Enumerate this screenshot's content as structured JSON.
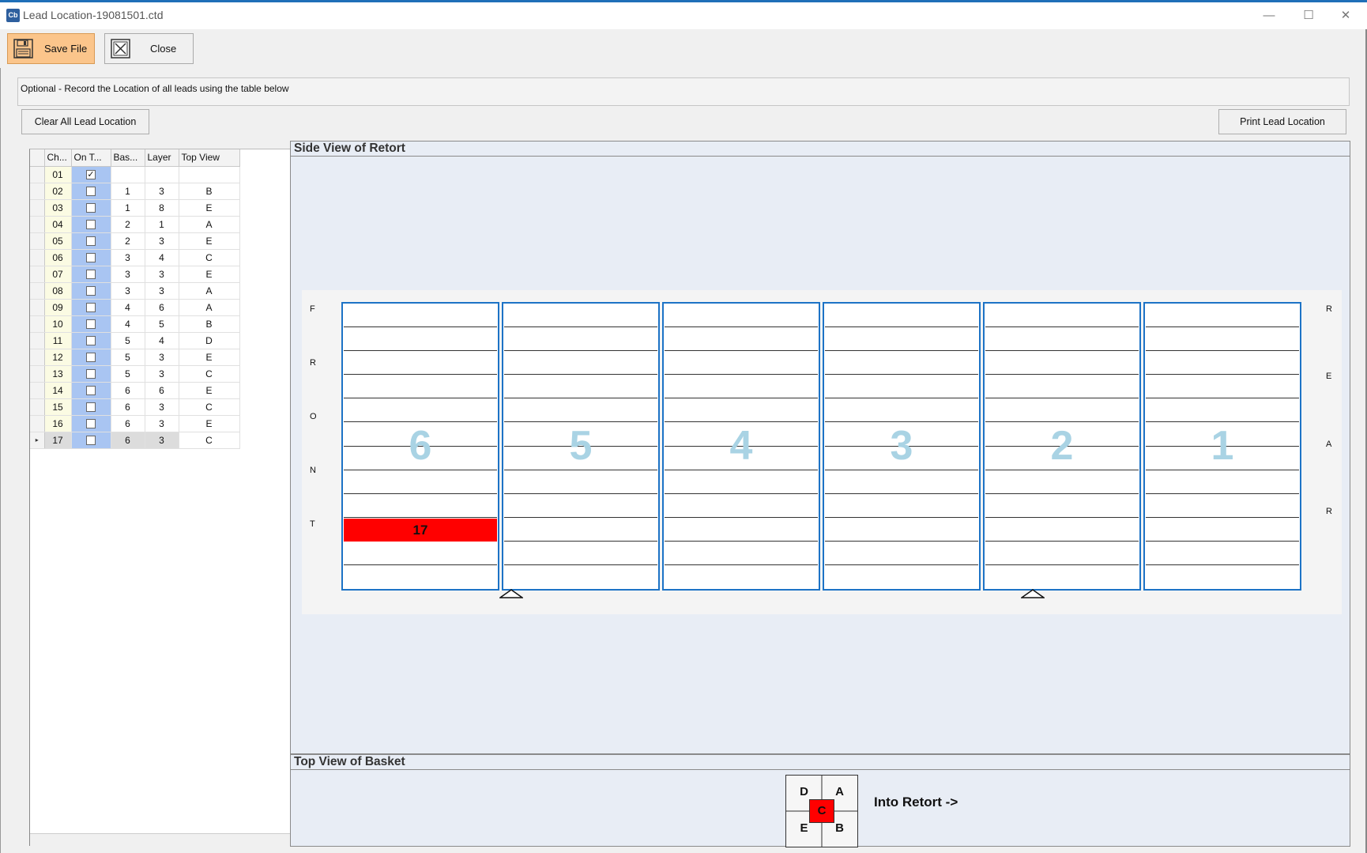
{
  "window": {
    "title": "Lead Location-19081501.ctd",
    "app_icon": "Cb",
    "minimize": "—",
    "maximize": "☐",
    "close": "✕"
  },
  "toolbar": {
    "save_label": "Save File",
    "save_icon": "floppy-disk-icon",
    "close_label": "Close",
    "close_icon": "close-box-icon",
    "save_color": "#fbc58b"
  },
  "instructions": "Optional - Record the Location of all leads using the table below",
  "actions": {
    "clear_label": "Clear All Lead Location",
    "print_label": "Print Lead Location"
  },
  "grid": {
    "columns": [
      "Ch...",
      "On T...",
      "Bas...",
      "Layer",
      "Top View"
    ],
    "current_row_marker": "▸",
    "rows": [
      {
        "ch": "01",
        "checked": true,
        "basket": "",
        "layer": "",
        "top": ""
      },
      {
        "ch": "02",
        "checked": false,
        "basket": "1",
        "layer": "3",
        "top": "B"
      },
      {
        "ch": "03",
        "checked": false,
        "basket": "1",
        "layer": "8",
        "top": "E"
      },
      {
        "ch": "04",
        "checked": false,
        "basket": "2",
        "layer": "1",
        "top": "A"
      },
      {
        "ch": "05",
        "checked": false,
        "basket": "2",
        "layer": "3",
        "top": "E"
      },
      {
        "ch": "06",
        "checked": false,
        "basket": "3",
        "layer": "4",
        "top": "C"
      },
      {
        "ch": "07",
        "checked": false,
        "basket": "3",
        "layer": "3",
        "top": "E"
      },
      {
        "ch": "08",
        "checked": false,
        "basket": "3",
        "layer": "3",
        "top": "A"
      },
      {
        "ch": "09",
        "checked": false,
        "basket": "4",
        "layer": "6",
        "top": "A"
      },
      {
        "ch": "10",
        "checked": false,
        "basket": "4",
        "layer": "5",
        "top": "B"
      },
      {
        "ch": "11",
        "checked": false,
        "basket": "5",
        "layer": "4",
        "top": "D"
      },
      {
        "ch": "12",
        "checked": false,
        "basket": "5",
        "layer": "3",
        "top": "E"
      },
      {
        "ch": "13",
        "checked": false,
        "basket": "5",
        "layer": "3",
        "top": "C"
      },
      {
        "ch": "14",
        "checked": false,
        "basket": "6",
        "layer": "6",
        "top": "E"
      },
      {
        "ch": "15",
        "checked": false,
        "basket": "6",
        "layer": "3",
        "top": "C"
      },
      {
        "ch": "16",
        "checked": false,
        "basket": "6",
        "layer": "3",
        "top": "E"
      },
      {
        "ch": "17",
        "checked": false,
        "basket": "6",
        "layer": "3",
        "top": "C",
        "current": true
      }
    ]
  },
  "side_view": {
    "title": "Side View of Retort",
    "left_letters": [
      "F",
      "R",
      "O",
      "N",
      "T"
    ],
    "right_letters": [
      "R",
      "E",
      "A",
      "R"
    ],
    "baskets": [
      "6",
      "5",
      "4",
      "3",
      "2",
      "1"
    ],
    "layers_per_basket": 12,
    "lead": {
      "label": "17",
      "basket": "6",
      "layer": "3"
    },
    "basket_border_color": "#1d73c6",
    "lead_color": "#ff0000",
    "number_color": "#a9d3e4"
  },
  "top_view": {
    "title": "Top View of Basket",
    "quadrants": {
      "tl": "D",
      "tr": "A",
      "bl": "E",
      "br": "B"
    },
    "center": "C",
    "direction_label": "Into Retort ->"
  }
}
